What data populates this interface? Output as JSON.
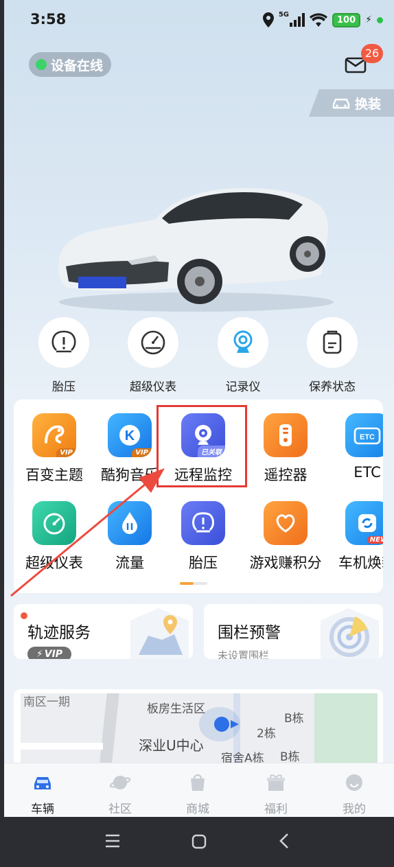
{
  "status_bar": {
    "time": "3:58",
    "network": "5G",
    "battery": "100"
  },
  "header": {
    "online_status": "设备在线",
    "mail_badge": "26",
    "swap_label": "换装"
  },
  "quick_actions": [
    {
      "label": "胎压",
      "icon": "tire-pressure-icon"
    },
    {
      "label": "超级仪表",
      "icon": "gauge-icon"
    },
    {
      "label": "记录仪",
      "icon": "dashcam-icon"
    },
    {
      "label": "保养状态",
      "icon": "maintenance-icon"
    }
  ],
  "app_grid": {
    "row1": [
      {
        "label": "百变主题",
        "tag": "VIP",
        "color": "#f59a1e"
      },
      {
        "label": "酷狗音乐",
        "tag": "VIP",
        "color": "#1e9bf0"
      },
      {
        "label": "远程监控",
        "tag": "已关联",
        "color": "#4a5ee6"
      },
      {
        "label": "遥控器",
        "tag": "",
        "color": "#f5822a"
      },
      {
        "label": "ETC",
        "tag": "",
        "color": "#1ea0f5"
      }
    ],
    "row2": [
      {
        "label": "超级仪表",
        "tag": "",
        "color": "#1fbf93"
      },
      {
        "label": "流量",
        "tag": "",
        "color": "#1e9bf0"
      },
      {
        "label": "胎压",
        "tag": "",
        "color": "#4a5ee6"
      },
      {
        "label": "游戏赚积分",
        "tag": "",
        "color": "#f5822a"
      },
      {
        "label": "车机焕新",
        "tag": "NEW",
        "color": "#1ea0f5"
      }
    ]
  },
  "services": {
    "track": {
      "title": "轨迹服务",
      "badge": "VIP"
    },
    "fence": {
      "title": "围栏预警",
      "subtitle": "未设置围栏"
    }
  },
  "map": {
    "labels": [
      "板房生活区",
      "深业U中心",
      "宿舍A栋",
      "B栋",
      "B栋",
      "2栋",
      "南区一期"
    ]
  },
  "bottom_nav": [
    {
      "label": "车辆",
      "active": true
    },
    {
      "label": "社区",
      "active": false
    },
    {
      "label": "商城",
      "active": false
    },
    {
      "label": "福利",
      "active": false
    },
    {
      "label": "我的",
      "active": false
    }
  ],
  "colors": {
    "accent": "#4a5ee6",
    "highlight": "#e53935",
    "badge": "#f15a42"
  }
}
